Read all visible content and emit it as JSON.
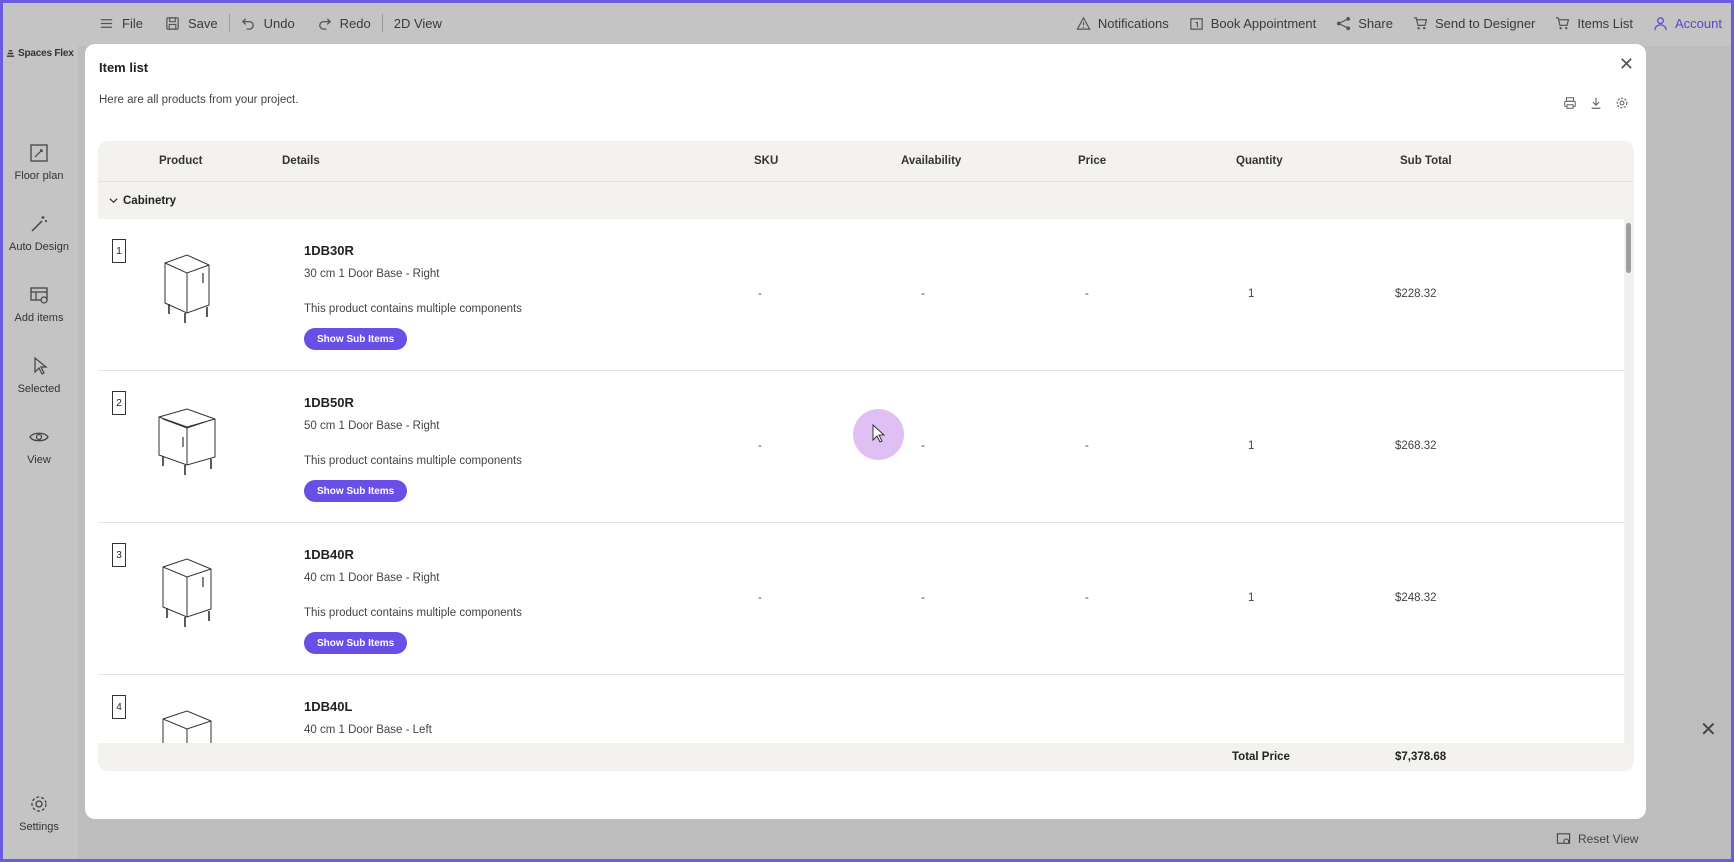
{
  "topbar": {
    "left": [
      {
        "label": "File",
        "icon": "menu-icon"
      },
      {
        "label": "Save",
        "icon": "save-icon"
      },
      {
        "label": "Undo",
        "icon": "undo-icon"
      },
      {
        "label": "Redo",
        "icon": "redo-icon"
      },
      {
        "label": "2D View",
        "icon": ""
      }
    ],
    "right": [
      {
        "label": "Notifications",
        "icon": "warning-icon"
      },
      {
        "label": "Book Appointment",
        "icon": "calendar-icon"
      },
      {
        "label": "Share",
        "icon": "share-icon"
      },
      {
        "label": "Send to Designer",
        "icon": "cart-icon"
      },
      {
        "label": "Items List",
        "icon": "cart-icon"
      },
      {
        "label": "Account",
        "icon": "user-icon"
      }
    ]
  },
  "sidebar": {
    "logo": "Spaces Flex",
    "items": [
      {
        "label": "Floor plan",
        "icon": "floor-plan-icon"
      },
      {
        "label": "Auto Design",
        "icon": "magic-wand-icon"
      },
      {
        "label": "Add items",
        "icon": "add-items-icon"
      },
      {
        "label": "Selected",
        "icon": "pointer-icon"
      },
      {
        "label": "View",
        "icon": "eye-icon"
      },
      {
        "label": "Settings",
        "icon": "gear-icon"
      }
    ]
  },
  "background": {
    "reset_view": "Reset View"
  },
  "modal": {
    "title": "Item list",
    "subtitle": "Here are all products from your project.",
    "columns": {
      "product": "Product",
      "details": "Details",
      "sku": "SKU",
      "availability": "Availability",
      "price": "Price",
      "quantity": "Quantity",
      "subtotal": "Sub Total"
    },
    "category": "Cabinetry",
    "rows": [
      {
        "num": "1",
        "name": "1DB30R",
        "desc": "30 cm 1 Door Base - Right",
        "note": "This product contains multiple components",
        "button": "Show Sub Items",
        "sku": "-",
        "availability": "-",
        "price": "-",
        "quantity": "1",
        "subtotal": "$228.32"
      },
      {
        "num": "2",
        "name": "1DB50R",
        "desc": "50 cm 1 Door Base - Right",
        "note": "This product contains multiple components",
        "button": "Show Sub Items",
        "sku": "-",
        "availability": "-",
        "price": "-",
        "quantity": "1",
        "subtotal": "$268.32"
      },
      {
        "num": "3",
        "name": "1DB40R",
        "desc": "40 cm 1 Door Base - Right",
        "note": "This product contains multiple components",
        "button": "Show Sub Items",
        "sku": "-",
        "availability": "-",
        "price": "-",
        "quantity": "1",
        "subtotal": "$248.32"
      },
      {
        "num": "4",
        "name": "1DB40L",
        "desc": "40 cm 1 Door Base - Left",
        "note": "",
        "button": "",
        "sku": "",
        "availability": "",
        "price": "",
        "quantity": "",
        "subtotal": ""
      }
    ],
    "total_label": "Total Price",
    "total_value": "$7,378.68"
  },
  "colors": {
    "accent": "#6a4fe6",
    "frame": "#6a5be0",
    "cursor_halo": "#d6aaf0"
  }
}
